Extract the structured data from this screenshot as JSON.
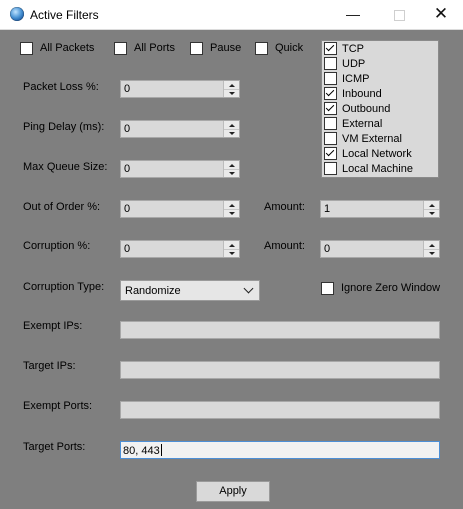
{
  "window": {
    "title": "Active Filters",
    "min_glyph": "—",
    "max_glyph": "",
    "close_glyph": "✕"
  },
  "top_options": [
    {
      "label": "All Packets",
      "checked": false
    },
    {
      "label": "All Ports",
      "checked": false
    },
    {
      "label": "Pause",
      "checked": false
    },
    {
      "label": "Quick",
      "checked": false
    }
  ],
  "filter_list": [
    {
      "label": "TCP",
      "checked": true
    },
    {
      "label": "UDP",
      "checked": false
    },
    {
      "label": "ICMP",
      "checked": false
    },
    {
      "label": "Inbound",
      "checked": true
    },
    {
      "label": "Outbound",
      "checked": true
    },
    {
      "label": "External",
      "checked": false
    },
    {
      "label": "VM External",
      "checked": false
    },
    {
      "label": "Local Network",
      "checked": true
    },
    {
      "label": "Local Machine",
      "checked": false
    }
  ],
  "fields": {
    "packet_loss": {
      "label": "Packet Loss %:",
      "value": "0"
    },
    "ping_delay": {
      "label": "Ping Delay (ms):",
      "value": "0"
    },
    "max_queue": {
      "label": "Max Queue Size:",
      "value": "0"
    },
    "out_of_order": {
      "label": "Out of Order %:",
      "value": "0"
    },
    "out_of_order_amount": {
      "label": "Amount:",
      "value": "1"
    },
    "corruption": {
      "label": "Corruption %:",
      "value": "0"
    },
    "corruption_amount": {
      "label": "Amount:",
      "value": "0"
    },
    "corruption_type": {
      "label": "Corruption Type:",
      "value": "Randomize"
    },
    "ignore_zero_window": {
      "label": "Ignore Zero Window",
      "checked": false
    },
    "exempt_ips": {
      "label": "Exempt IPs:",
      "value": ""
    },
    "target_ips": {
      "label": "Target IPs:",
      "value": ""
    },
    "exempt_ports": {
      "label": "Exempt Ports:",
      "value": ""
    },
    "target_ports": {
      "label": "Target Ports:",
      "value": "80, 443"
    }
  },
  "apply_label": "Apply"
}
